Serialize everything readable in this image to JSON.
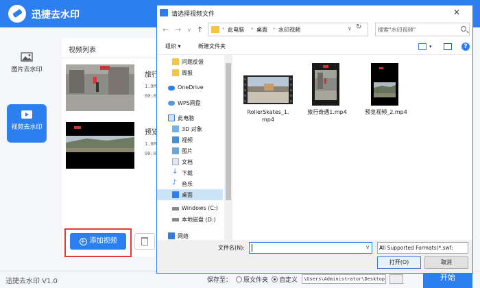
{
  "app": {
    "title": "迅捷去水印",
    "version": "迅捷去水印 V1.0",
    "accent_color": "#2d7ff0",
    "sidebar": [
      {
        "label": "图片去水印",
        "icon": "image-icon",
        "active": false
      },
      {
        "label": "视频去水印",
        "icon": "video-icon",
        "active": true
      }
    ],
    "main": {
      "title": "视频列表",
      "videos": [
        {
          "name": "旅行",
          "meta1": "1.9M",
          "meta2": "00:0"
        },
        {
          "name": "预览",
          "meta1": "1.0M",
          "meta2": "00:0"
        }
      ],
      "add_button": "添加视频",
      "delete_icon": "trash-icon"
    },
    "footer": {
      "save_label": "保存至：",
      "radio_original": "原文件夹",
      "radio_custom": "自定义",
      "save_path": "\\Users\\Administrator\\Desktop",
      "start_button": "开始"
    }
  },
  "dialog": {
    "title": "请选择视频文件",
    "close": "✕",
    "breadcrumb": [
      "此电脑",
      "桌面",
      "水印视频"
    ],
    "search_placeholder": "搜索\"水印视频\"",
    "toolbar": {
      "organize": "组织 ▾",
      "new_folder": "新建文件夹"
    },
    "nav_items": [
      {
        "label": "问题反馈",
        "icon": "document-icon"
      },
      {
        "label": "周报",
        "icon": "folder-icon"
      },
      {
        "label": "OneDrive",
        "icon": "cloud-icon"
      },
      {
        "label": "WPS网盘",
        "icon": "cloud-icon"
      },
      {
        "label": "此电脑",
        "icon": "computer-icon"
      },
      {
        "label": "3D 对象",
        "icon": "cube-icon"
      },
      {
        "label": "视频",
        "icon": "video-folder-icon"
      },
      {
        "label": "图片",
        "icon": "picture-folder-icon"
      },
      {
        "label": "文档",
        "icon": "document-folder-icon"
      },
      {
        "label": "下载",
        "icon": "download-icon"
      },
      {
        "label": "音乐",
        "icon": "music-icon"
      },
      {
        "label": "桌面",
        "icon": "desktop-icon",
        "selected": true
      },
      {
        "label": "Windows (C:)",
        "icon": "drive-icon"
      },
      {
        "label": "本地磁盘 (D:)",
        "icon": "drive-icon"
      },
      {
        "label": "网络",
        "icon": "network-icon"
      }
    ],
    "files": [
      {
        "name_line1": "RollerSkates_1.",
        "name_line2": "mp4"
      },
      {
        "name_line1": "旅行奇遇1.mp4",
        "name_line2": ""
      },
      {
        "name_line1": "预览视频_2.mp4",
        "name_line2": ""
      }
    ],
    "filename_label": "文件名(N):",
    "filename_value": "",
    "file_type": "All Supported Formats(*.swf;",
    "open_button": "打开(O)",
    "cancel_button": "取消"
  }
}
